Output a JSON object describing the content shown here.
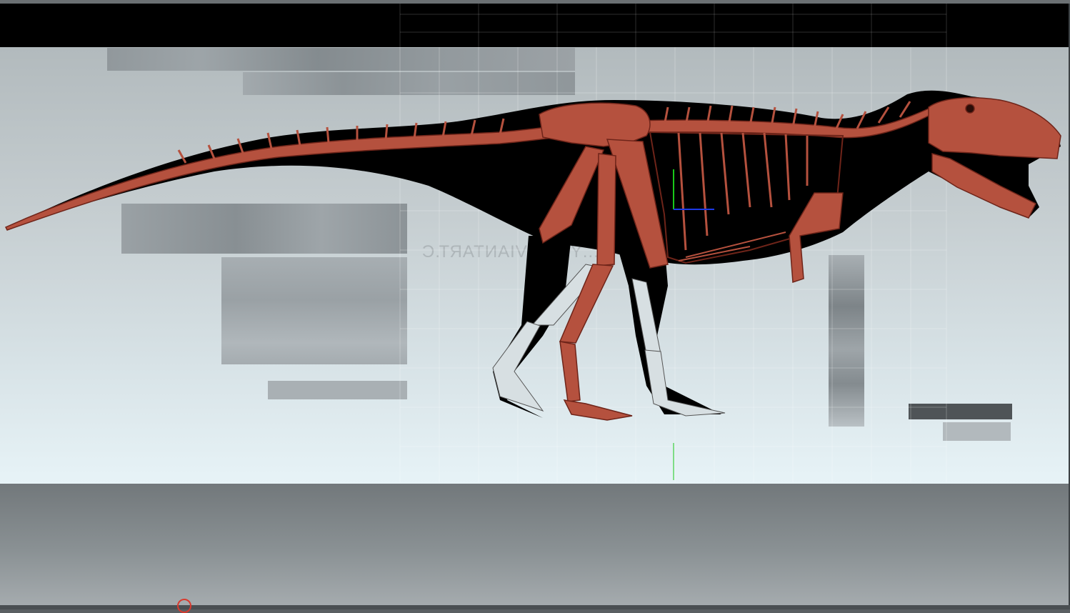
{
  "watermark": {
    "text": "...YS.DEVIANTART.C"
  },
  "colors": {
    "bone": "#b5513e",
    "bone_dark": "#7a2a1f",
    "shadow": "#000000",
    "ghost_bone": "#d7dfe2",
    "axis_green": "#19c919",
    "axis_blue": "#1c39e8",
    "cursor": "#d83a2e"
  },
  "icons": {
    "cursor": "brush-cursor-icon",
    "axis": "transform-gizmo-icon"
  }
}
